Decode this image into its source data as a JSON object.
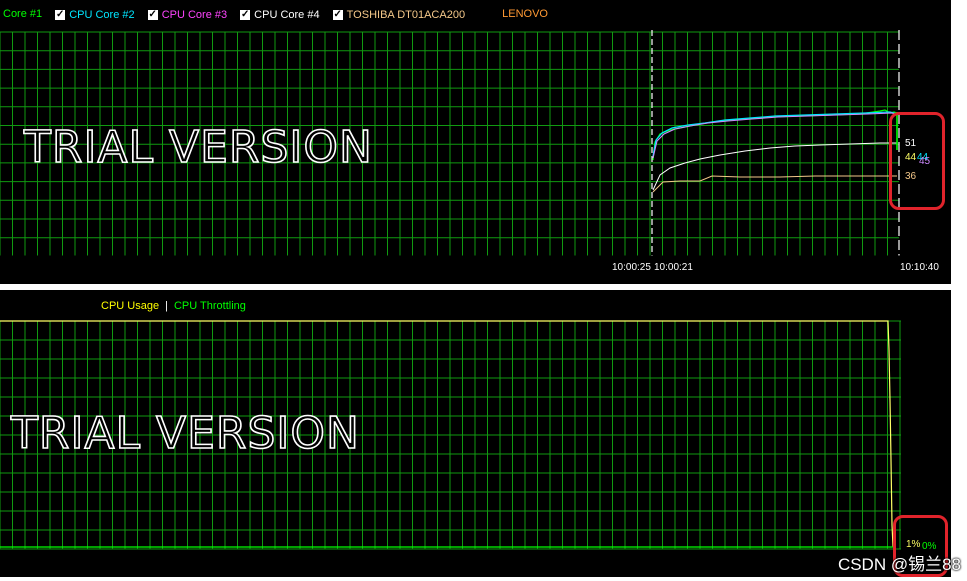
{
  "top_legend": [
    {
      "label": "Core #1",
      "color": "#00ff00",
      "checkbox": false
    },
    {
      "label": "CPU Core #2",
      "color": "#00e5ff",
      "checkbox": true
    },
    {
      "label": "CPU Core #3",
      "color": "#ff44ff",
      "checkbox": true
    },
    {
      "label": "CPU Core #4",
      "color": "#ffffff",
      "checkbox": true
    },
    {
      "label": "TOSHIBA DT01ACA200",
      "color": "#f5c98a",
      "checkbox": true
    },
    {
      "label": "LENOVO",
      "color": "#ff9933",
      "checkbox": false
    }
  ],
  "top_chart": {
    "watermark": "TRIAL VERSION",
    "time_labels": [
      "10:00:25",
      "10:00:21",
      "10:10:40"
    ],
    "current_values": [
      {
        "text": "51",
        "color": "#ffffff"
      },
      {
        "text": "44",
        "color": "#ffff66"
      },
      {
        "text": "44",
        "color": "#00e5ff"
      },
      {
        "text": "45",
        "color": "#cc88ff"
      },
      {
        "text": "36",
        "color": "#f5c98a"
      }
    ]
  },
  "bottom_legend": [
    {
      "label": "CPU Usage",
      "color": "#ffff00"
    },
    {
      "label": "CPU Throttling",
      "color": "#00ff00"
    }
  ],
  "bottom_chart": {
    "watermark": "TRIAL VERSION",
    "current_values": [
      {
        "text": "1%",
        "color": "#ffff66"
      },
      {
        "text": "0%",
        "color": "#00ff00"
      }
    ]
  },
  "footer": {
    "watermark": "CSDN @锡兰88"
  }
}
